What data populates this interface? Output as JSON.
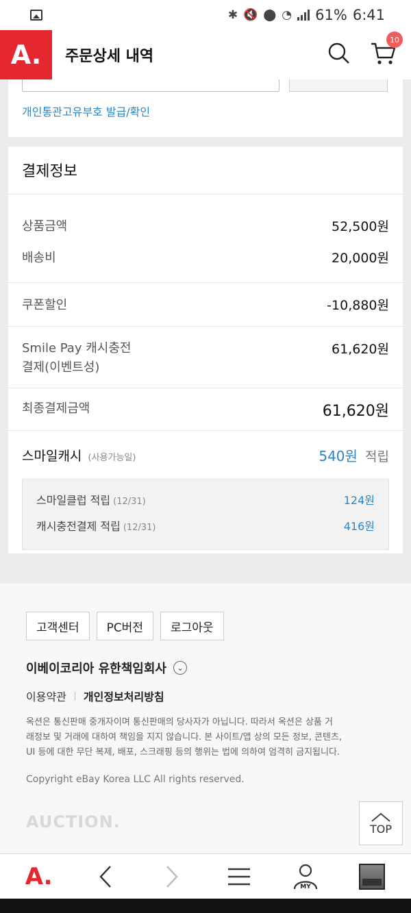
{
  "status_bar": {
    "battery": "61%",
    "time": "6:41"
  },
  "header": {
    "logo": "A.",
    "title": "주문상세 내역",
    "cart_count": "10"
  },
  "top_card": {
    "link": "개인통관고유부호 발급/확인"
  },
  "payment": {
    "title": "결제정보",
    "product_label": "상품금액",
    "product_value": "52,500원",
    "shipping_label": "배송비",
    "shipping_value": "20,000원",
    "coupon_label": "쿠폰할인",
    "coupon_value": "-10,880원",
    "smilepay_label_1": "Smile Pay 캐시충전",
    "smilepay_label_2": "결제(이벤트성)",
    "smilepay_value": "61,620원",
    "final_label": "최종결제금액",
    "final_value": "61,620원",
    "smilecash_label": "스마일캐시",
    "smilecash_sub": "(사용가능일)",
    "smilecash_amount": "540원",
    "smilecash_suffix": "적립",
    "details": [
      {
        "label": "스마일클럽 적립",
        "date": "(12/31)",
        "value": "124원"
      },
      {
        "label": "캐시충전결제 적립",
        "date": "(12/31)",
        "value": "416원"
      }
    ]
  },
  "footer": {
    "btn_customer": "고객센터",
    "btn_pc": "PC버전",
    "btn_logout": "로그아웃",
    "company": "이베이코리아 유한책임회사",
    "terms": "이용약관",
    "privacy": "개인정보처리방침",
    "notice_1": "옥션은 통신판매 중개자이며 통신판매의 당사자가 아닙니다. 따라서 옥션은 상품 거",
    "notice_2": "래정보 및 거래에 대하여 책임을 지지 않습니다. 본 사이트/앱 상의 모든 정보, 콘텐츠,",
    "notice_3": "UI 등에 대한 무단 복제, 배포, 스크래핑 등의 행위는 법에 의하여 엄격히 금지됩니다.",
    "copyright": "Copyright eBay Korea LLC All rights reserved.",
    "brand": "AUCTION.",
    "top_label": "TOP"
  },
  "bottom_nav": {
    "home_logo": "A.",
    "my_label": "MY"
  },
  "colors": {
    "brand_red": "#e5272f",
    "link_blue": "#2a85c8",
    "badge": "#f05d5d"
  }
}
